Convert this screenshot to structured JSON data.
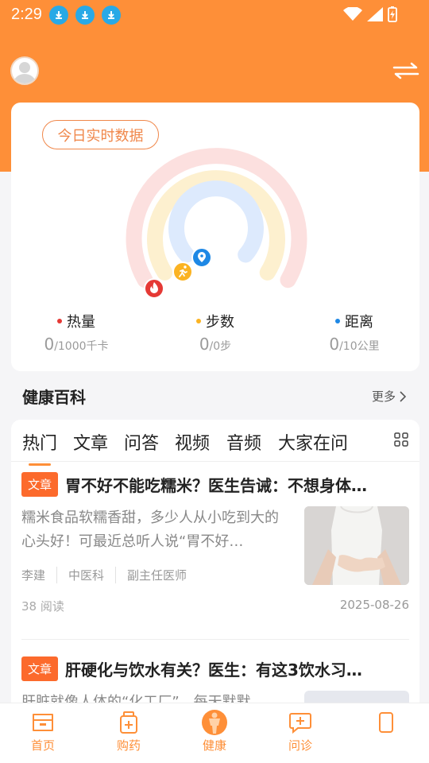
{
  "status": {
    "time": "2:29"
  },
  "card": {
    "today_label": "今日实时数据",
    "stats": [
      {
        "label": "热量",
        "value": "0",
        "unit": "/1000千卡",
        "color": "#e53935"
      },
      {
        "label": "步数",
        "value": "0",
        "unit": "/0步",
        "color": "#fbb322"
      },
      {
        "label": "距离",
        "value": "0",
        "unit": "/10公里",
        "color": "#1e88e5"
      }
    ]
  },
  "section": {
    "title": "健康百科",
    "more": "更多"
  },
  "tabs": [
    "热门",
    "文章",
    "问答",
    "视频",
    "音频",
    "大家在问"
  ],
  "articles": [
    {
      "tag": "文章",
      "title": "胃不好不能吃糯米？医生告诫：不想身体…",
      "excerpt": "糯米食品软糯香甜，多少人从小吃到大的心头好！可最近总听人说“胃不好…",
      "author": "李建",
      "department": "中医科",
      "position": "副主任医师",
      "reads": "38 阅读",
      "date": "2025-08-26"
    },
    {
      "tag": "文章",
      "title": "肝硬化与饮水有关？医生：有这3饮水习…",
      "excerpt": "肝脏就像人体的“化工厂”，每天默默"
    }
  ],
  "nav": [
    "首页",
    "购药",
    "健康",
    "问诊",
    ""
  ]
}
